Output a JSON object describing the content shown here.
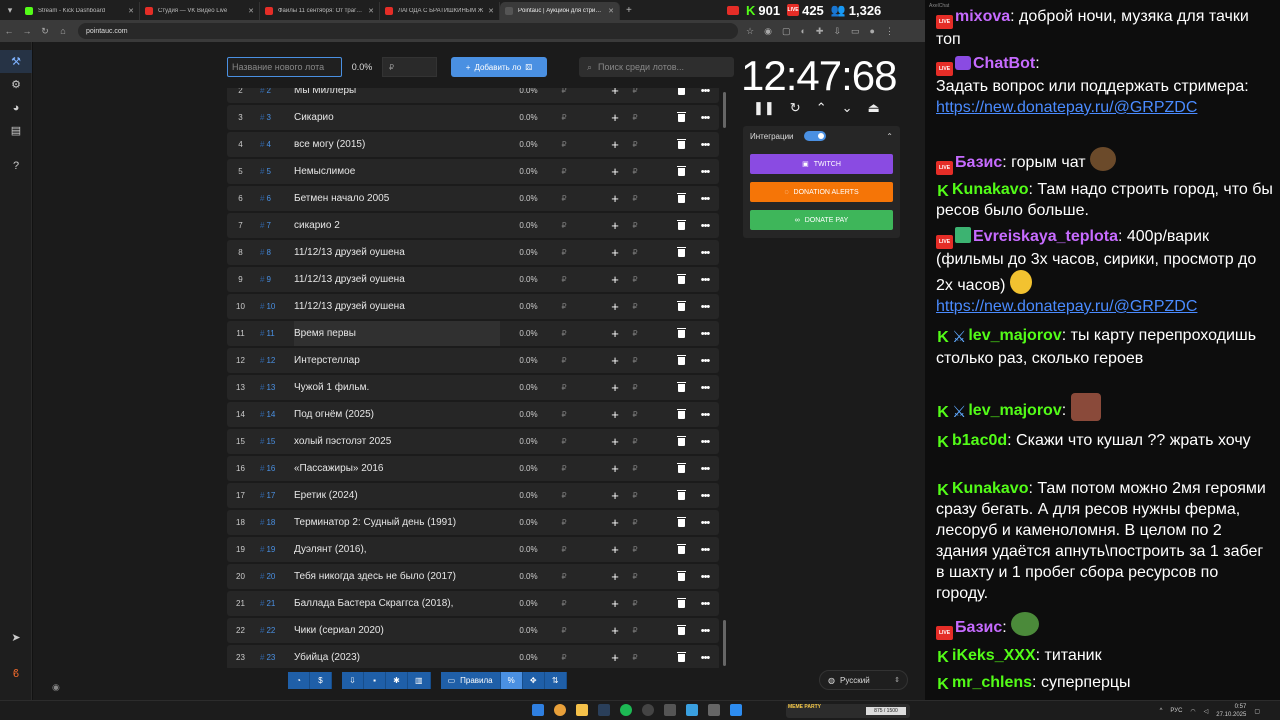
{
  "browser": {
    "tabs": [
      {
        "title": "Stream - Kick Dashboard",
        "color": "#53fc18"
      },
      {
        "title": "Студия — VK Видео Live",
        "color": "#e52d27"
      },
      {
        "title": "Файлы 11 сентября: От трагедии",
        "color": "#e52d27"
      },
      {
        "title": "ЛАГОДА С БРАТИШКИНЫМ Ж",
        "color": "#e52d27"
      },
      {
        "title": "Pointauc | Аукцион для стримов",
        "color": "#555555"
      }
    ],
    "url": "pointauc.com"
  },
  "stats": {
    "kick": "901",
    "vk": "425",
    "users": "1,326"
  },
  "auction": {
    "new_lot_placeholder": "Название нового лота",
    "percent": "0.0%",
    "rub_placeholder": "₽",
    "add_label": "Добавить ло",
    "search_placeholder": "Поиск среди лотов...",
    "timer": "12:47:68",
    "integrations_label": "Интеграции",
    "twitch": "TWITCH",
    "donation_alerts": "DONATION ALERTS",
    "donate_pay": "DONATE PAY",
    "language": "Русский",
    "rules": "Правила",
    "lots": [
      {
        "n": "2",
        "id": "2",
        "name": "Мы Миллеры",
        "pct": "0.0%"
      },
      {
        "n": "3",
        "id": "3",
        "name": "Сикарио",
        "pct": "0.0%"
      },
      {
        "n": "4",
        "id": "4",
        "name": "все могу (2015)",
        "pct": "0.0%"
      },
      {
        "n": "5",
        "id": "5",
        "name": "Немыслимое",
        "pct": "0.0%"
      },
      {
        "n": "6",
        "id": "6",
        "name": "Бетмен начало 2005",
        "pct": "0.0%"
      },
      {
        "n": "7",
        "id": "7",
        "name": "сикарио 2",
        "pct": "0.0%"
      },
      {
        "n": "8",
        "id": "8",
        "name": "11/12/13 друзей оушена",
        "pct": "0.0%"
      },
      {
        "n": "9",
        "id": "9",
        "name": "11/12/13 друзей оушена",
        "pct": "0.0%"
      },
      {
        "n": "10",
        "id": "10",
        "name": "11/12/13 друзей оушена",
        "pct": "0.0%"
      },
      {
        "n": "11",
        "id": "11",
        "name": "Время первы",
        "pct": "0.0%"
      },
      {
        "n": "12",
        "id": "12",
        "name": "Интерстеллар",
        "pct": "0.0%"
      },
      {
        "n": "13",
        "id": "13",
        "name": "Чужой 1 фильм.",
        "pct": "0.0%"
      },
      {
        "n": "14",
        "id": "14",
        "name": "Под огнём (2025)",
        "pct": "0.0%"
      },
      {
        "n": "15",
        "id": "15",
        "name": "холый пэстолэт 2025",
        "pct": "0.0%"
      },
      {
        "n": "16",
        "id": "16",
        "name": "«Пассажиры» 2016",
        "pct": "0.0%"
      },
      {
        "n": "17",
        "id": "17",
        "name": "Еретик (2024)",
        "pct": "0.0%"
      },
      {
        "n": "18",
        "id": "18",
        "name": "Терминатор 2: Судный день (1991)",
        "pct": "0.0%"
      },
      {
        "n": "19",
        "id": "19",
        "name": "Дуэлянт (2016),",
        "pct": "0.0%"
      },
      {
        "n": "20",
        "id": "20",
        "name": "Тебя никогда здесь не было (2017)",
        "pct": "0.0%"
      },
      {
        "n": "21",
        "id": "21",
        "name": "Баллада Бастера Скраггса (2018),",
        "pct": "0.0%"
      },
      {
        "n": "22",
        "id": "22",
        "name": "Чики (сериал 2020)",
        "pct": "0.0%"
      },
      {
        "n": "23",
        "id": "23",
        "name": "Убийца (2023)",
        "pct": "0.0%"
      }
    ]
  },
  "chat": {
    "header": "AxelChat",
    "messages": [
      {
        "nick": "mixova",
        "text": "доброй ночи, музяка для тачки топ"
      },
      {
        "nick": "ChatBot",
        "text": "Задать вопрос или поддержать стримера:",
        "link": "https://new.donatepay.ru/@GRPZDC"
      },
      {
        "nick": "Базис",
        "text": "горым чат"
      },
      {
        "nick": "Kunakavo",
        "text": "Там надо строить город, что бы ресов было больше."
      },
      {
        "nick": "Evreiskaya_teplota",
        "text": "400р/варик (фильмы до 3х часов, сирики, просмотр до 2х часов)",
        "link": "https://new.donatepay.ru/@GRPZDC"
      },
      {
        "nick": "lev_majorov",
        "text": "ты карту перепроходишь столько раз, сколько героев"
      },
      {
        "nick": "lev_majorov",
        "text": ""
      },
      {
        "nick": "b1ac0d",
        "text": "Скажи что кушал ?? жрать хочу"
      },
      {
        "nick": "Kunakavo",
        "text": "Там потом можно 2мя героями сразу бегать. А для ресов нужны ферма, лесоруб и каменоломня. В целом по 2 здания удаётся апнуть\\построить за 1 забег в шахту и 1 пробег сбора ресурсов по городу."
      },
      {
        "nick": "Базис",
        "text": ""
      },
      {
        "nick": "iKeks_XXX",
        "text": "титаник"
      },
      {
        "nick": "mr_chlens",
        "text": "суперперцы"
      }
    ]
  },
  "taskbar": {
    "meme": "MEME PARTY",
    "meme_progress": "875 / 1500",
    "lang": "РУС",
    "time": "0:57",
    "date": "27.10.2025"
  }
}
